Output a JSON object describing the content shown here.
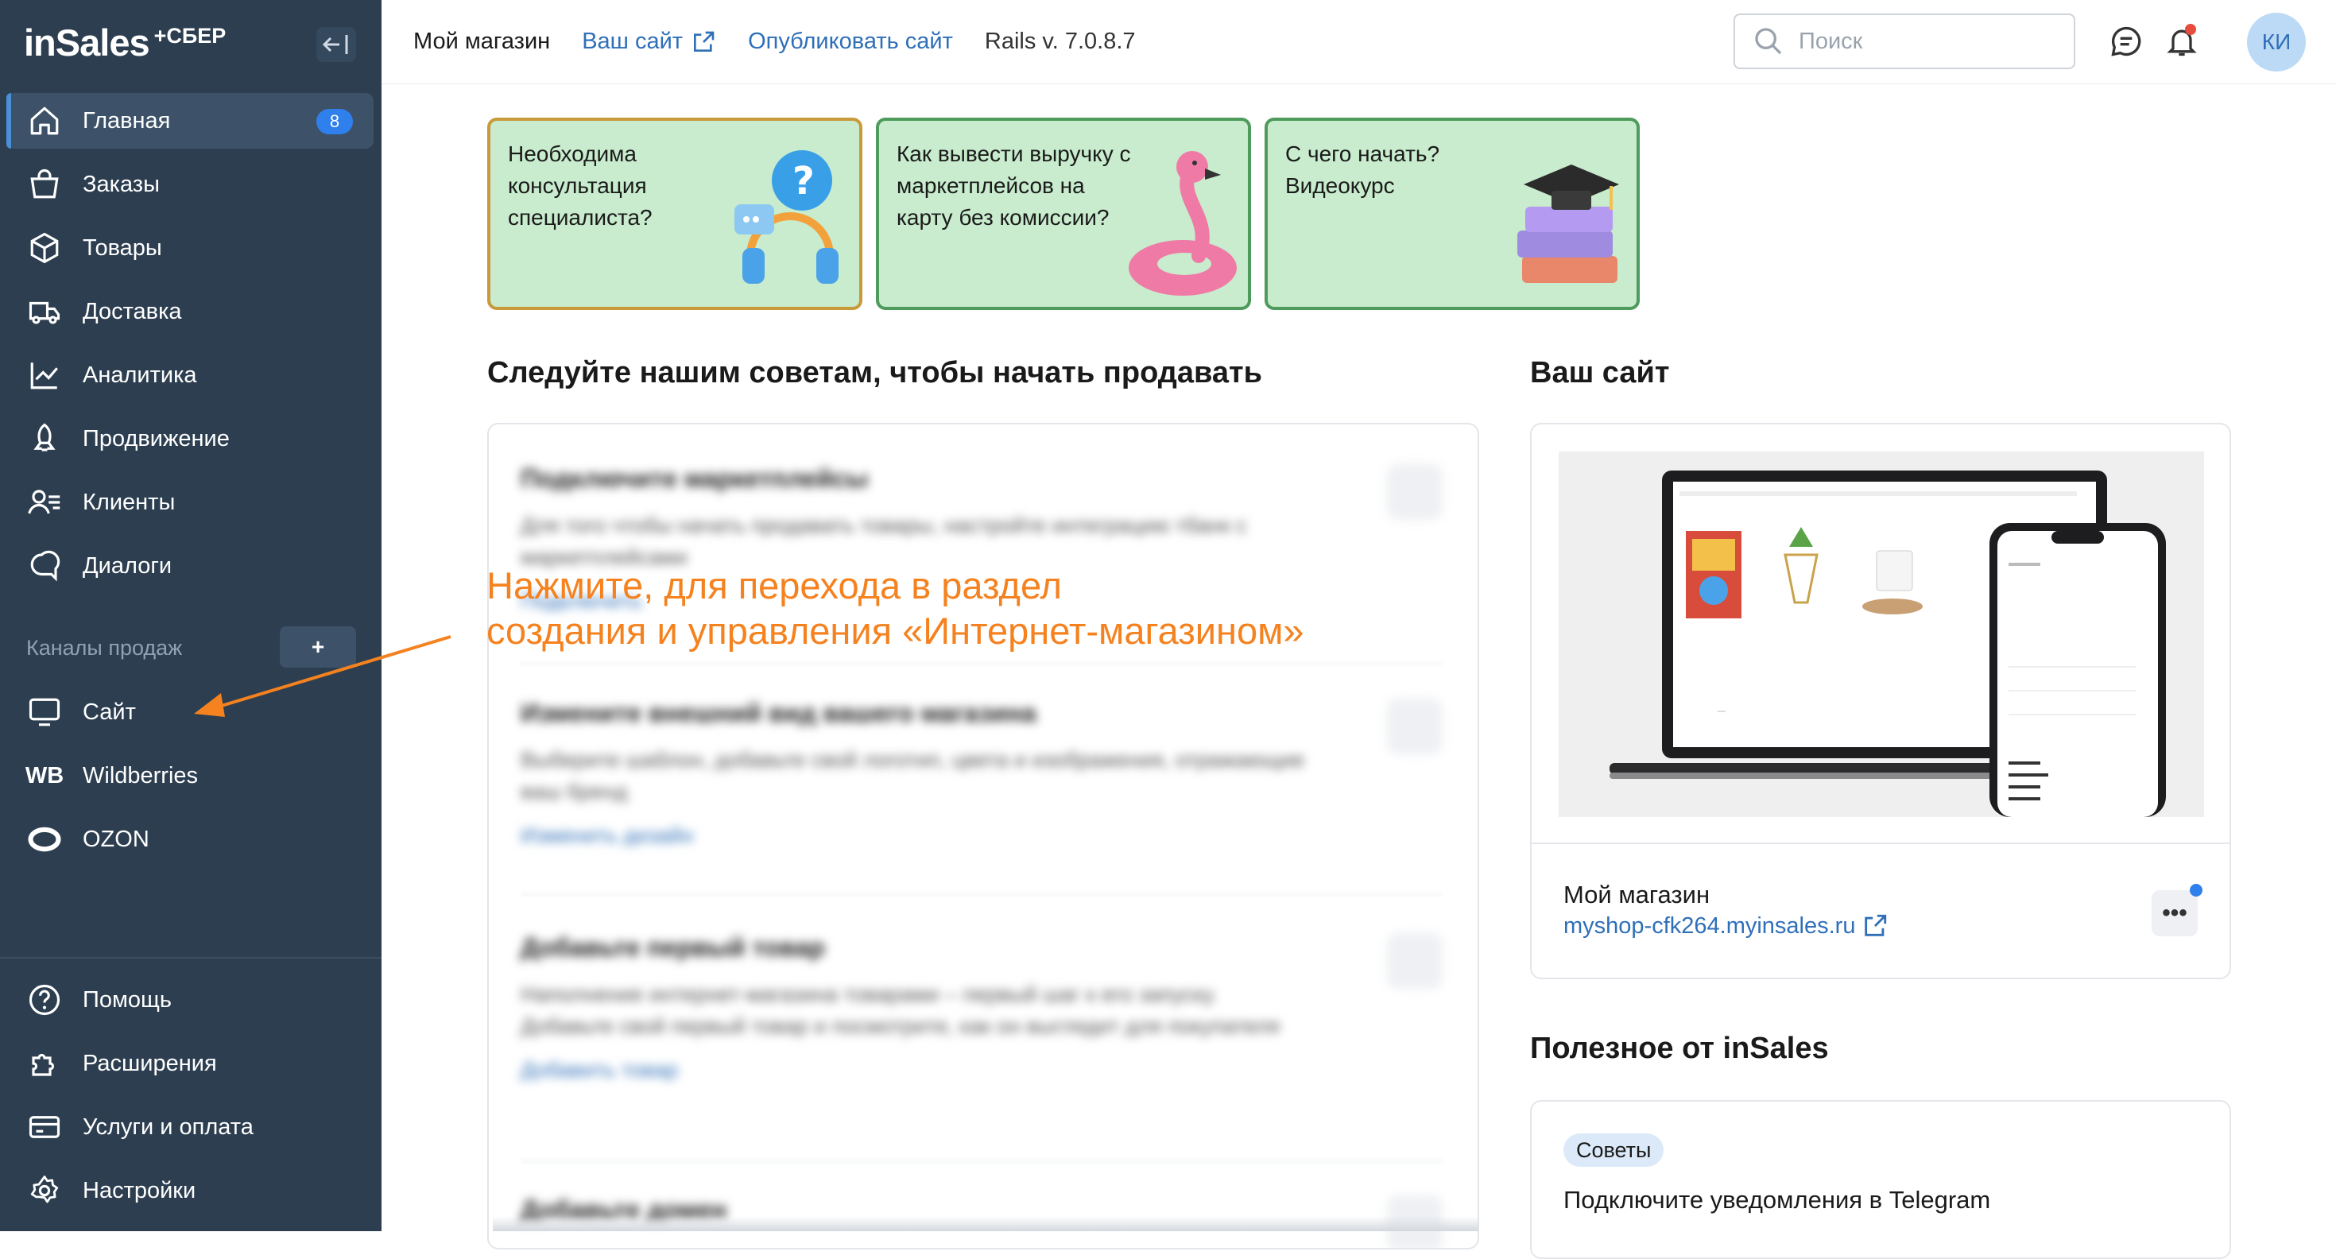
{
  "sidebar": {
    "logo": "inSales",
    "logo_suffix": "+СБЕР",
    "nav": [
      {
        "label": "Главная",
        "icon": "home-icon",
        "badge": "8"
      },
      {
        "label": "Заказы",
        "icon": "bag-icon"
      },
      {
        "label": "Товары",
        "icon": "box-icon"
      },
      {
        "label": "Доставка",
        "icon": "truck-icon"
      },
      {
        "label": "Аналитика",
        "icon": "chart-icon"
      },
      {
        "label": "Продвижение",
        "icon": "rocket-icon"
      },
      {
        "label": "Клиенты",
        "icon": "users-icon"
      },
      {
        "label": "Диалоги",
        "icon": "chat-icon"
      }
    ],
    "channels_label": "Каналы продаж",
    "channels_add": "+",
    "channels": [
      {
        "label": "Сайт",
        "icon": "monitor-icon"
      },
      {
        "label": "Wildberries",
        "icon_text": "WB"
      },
      {
        "label": "OZON",
        "icon": "ozon-icon"
      }
    ],
    "bottom": [
      {
        "label": "Помощь",
        "icon": "help-icon"
      },
      {
        "label": "Расширения",
        "icon": "puzzle-icon"
      },
      {
        "label": "Услуги и оплата",
        "icon": "card-icon"
      },
      {
        "label": "Настройки",
        "icon": "gear-icon"
      }
    ]
  },
  "header": {
    "store": "Мой магазин",
    "your_site": "Ваш сайт",
    "publish": "Опубликовать сайт",
    "rails": "Rails v. 7.0.8.7",
    "search_placeholder": "Поиск",
    "avatar": "КИ"
  },
  "promos": [
    {
      "text": "Необходима консультация специалиста?"
    },
    {
      "text": "Как вывести выручку с маркетплейсов на карту без комиссии?"
    },
    {
      "text": "С чего начать? Видеокурс"
    }
  ],
  "tips": {
    "title": "Следуйте нашим советам, чтобы начать продавать",
    "items": [
      {
        "title": "Подключите маркетплейсы",
        "desc": "Для того чтобы начать продавать товары, настройте интеграцию тбанк с маркетплейсами",
        "link": "Подключить"
      },
      {
        "title": "Измените внешний вид вашего магазина",
        "desc": "Выберите шаблон, добавьте свой логотип, цвета и изображения, отражающие ваш бренд",
        "link": "Изменить дизайн"
      },
      {
        "title": "Добавьте первый товар",
        "desc": "Наполнение интернет-магазина товарами – первый шаг к его запуску. Добавьте свой первый товар и посмотрите, как он выглядит для покупателя",
        "link": "Добавить товар"
      },
      {
        "title": "Добавьте домен"
      }
    ]
  },
  "annotation": {
    "line1": "Нажмите, для перехода в раздел",
    "line2": "создания и управления «Интернет-магазином»"
  },
  "site": {
    "title": "Ваш сайт",
    "name": "Мой магазин",
    "url": "myshop-cfk264.myinsales.ru",
    "more": "•••"
  },
  "useful": {
    "title": "Полезное от inSales",
    "tag": "Советы",
    "card_title": "Подключите уведомления в Telegram"
  },
  "colors": {
    "sidebar_bg": "#2c3e50",
    "accent": "#2f80ed",
    "link": "#2f6fb8",
    "annotation": "#f5821f",
    "promo_bg": "#c8eccd"
  }
}
